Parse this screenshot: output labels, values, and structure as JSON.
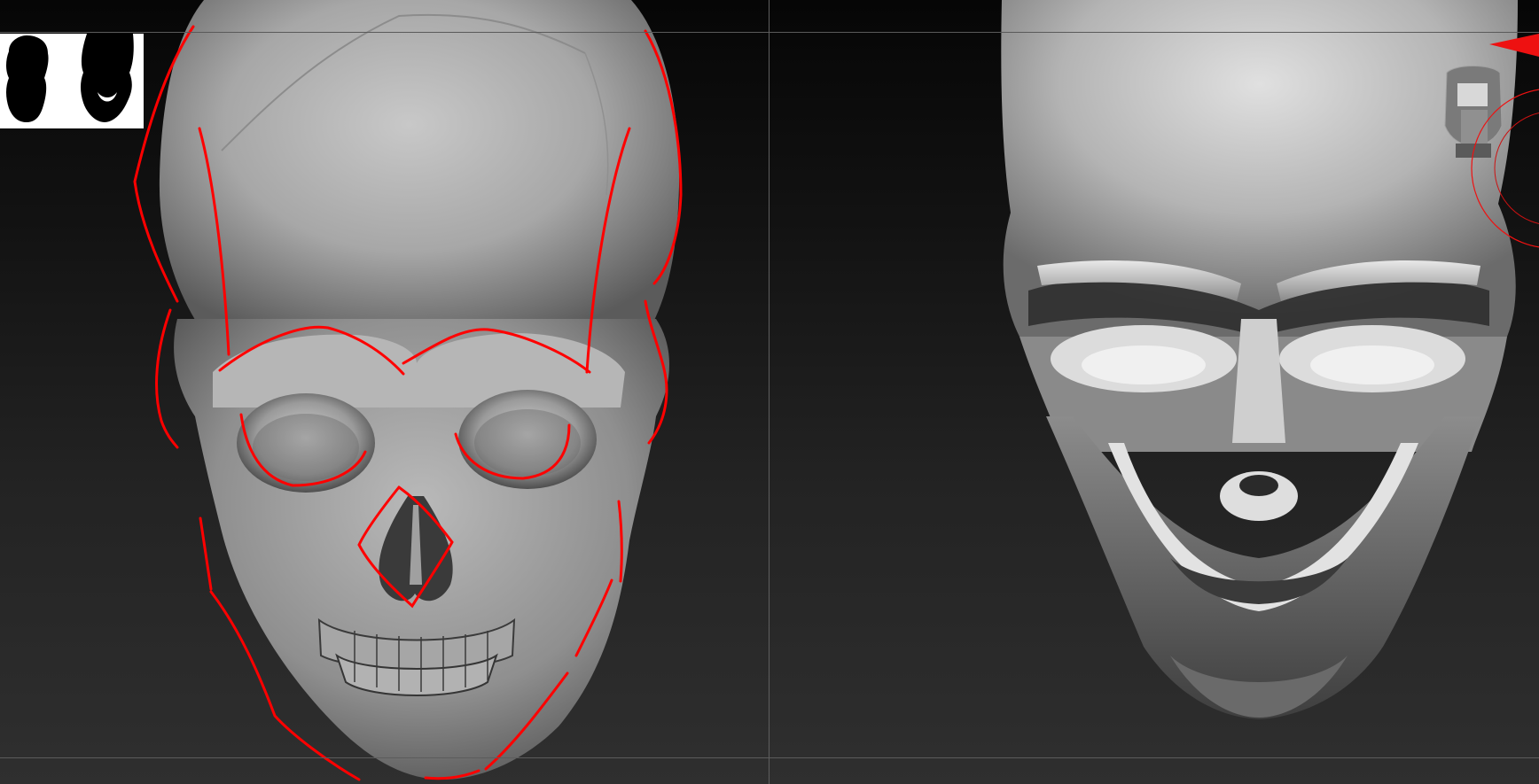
{
  "viewport": {
    "background_top": "#060606",
    "background_bottom": "#2f2f2f",
    "guide_color": "#5e5e5e"
  },
  "overlay": {
    "stroke_color": "#ff0000",
    "accent_color": "#ee1111"
  },
  "models": {
    "left": "skull-detailed-with-red-guide-lines",
    "right": "skull-blockout-sculpt"
  },
  "thumbnail": {
    "background": "#ffffff",
    "silhouettes": [
      "skull-front-silhouette-icon",
      "skull-blockout-silhouette-icon"
    ]
  },
  "navigation": {
    "icon": "navigation-cube-icon"
  }
}
